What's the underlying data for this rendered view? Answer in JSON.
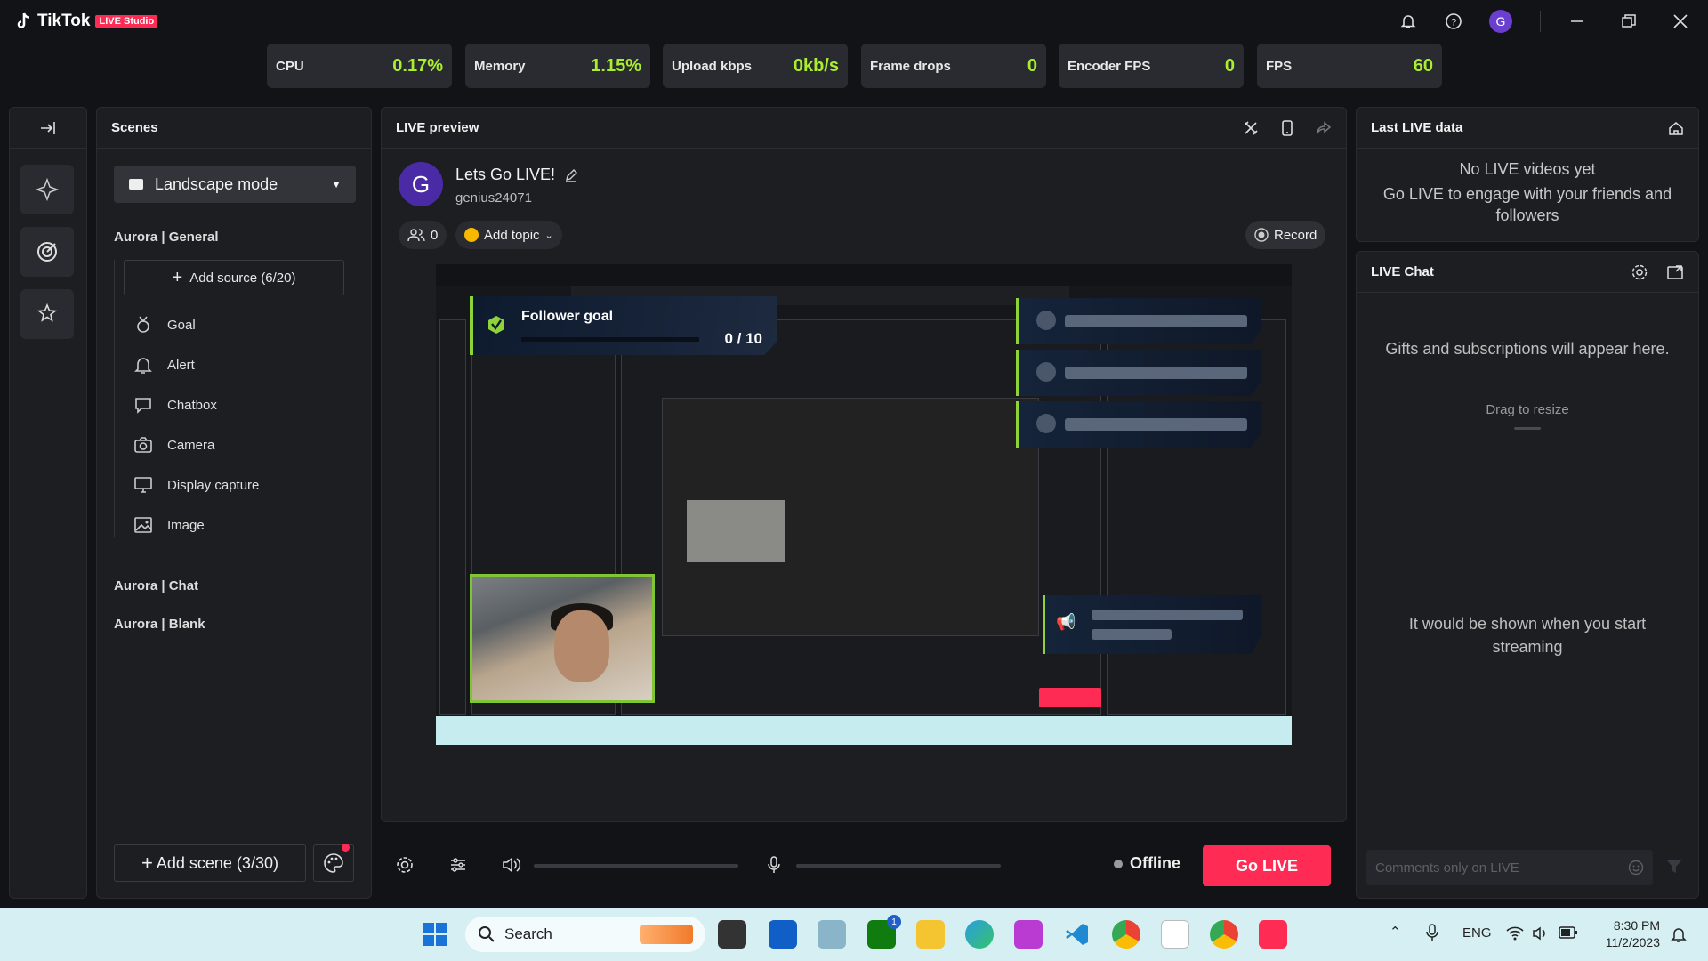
{
  "app": {
    "brand": "TikTok",
    "badge": "LIVE Studio",
    "avatar_letter": "G"
  },
  "stats": [
    {
      "label": "CPU",
      "value": "0.17%"
    },
    {
      "label": "Memory",
      "value": "1.15%"
    },
    {
      "label": "Upload kbps",
      "value": "0kb/s"
    },
    {
      "label": "Frame drops",
      "value": "0"
    },
    {
      "label": "Encoder FPS",
      "value": "0"
    },
    {
      "label": "FPS",
      "value": "60"
    }
  ],
  "scenes": {
    "title": "Scenes",
    "mode": "Landscape mode",
    "group1": "Aurora | General",
    "add_source": "Add source (6/20)",
    "sources": [
      "Goal",
      "Alert",
      "Chatbox",
      "Camera",
      "Display capture",
      "Image"
    ],
    "group2": "Aurora | Chat",
    "group3": "Aurora | Blank",
    "add_scene": "Add scene (3/30)"
  },
  "preview": {
    "title": "LIVE preview",
    "stream_title": "Lets Go LIVE!",
    "username": "genius24071",
    "avatar_letter": "G",
    "viewers": "0",
    "add_topic": "Add topic",
    "record": "Record",
    "goal_title": "Follower goal",
    "goal_value": "0 / 10",
    "status": "Offline",
    "go_live": "Go LIVE"
  },
  "last_live": {
    "title": "Last LIVE data",
    "line1": "No LIVE videos yet",
    "line2": "Go LIVE to engage with your friends and followers"
  },
  "live_chat": {
    "title": "LIVE Chat",
    "gifts_text": "Gifts and subscriptions will appear here.",
    "resize_text": "Drag to resize",
    "stream_text": "It would be shown when you start streaming",
    "comment_placeholder": "Comments only on LIVE"
  },
  "taskbar": {
    "search": "Search",
    "lang": "ENG",
    "time": "8:30 PM",
    "date": "11/2/2023",
    "xbox_badge": "1"
  },
  "colors": {
    "accent_green": "#a9ef2d",
    "brand_red": "#fe2c55"
  }
}
